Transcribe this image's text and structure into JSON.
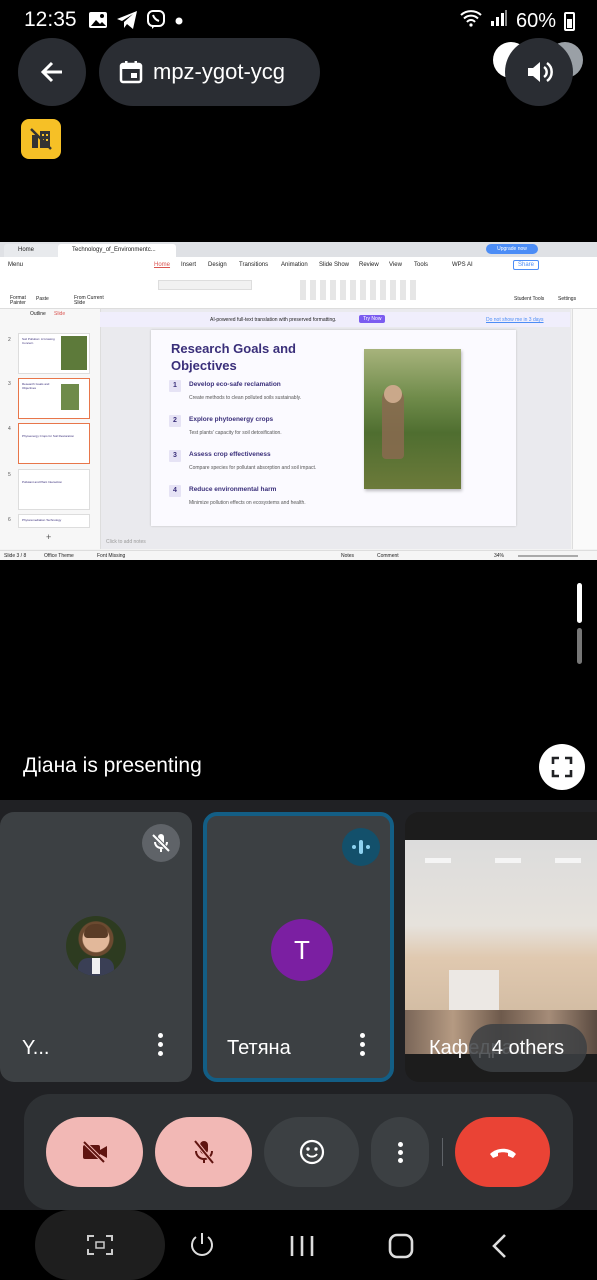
{
  "status_bar": {
    "time": "12:35",
    "battery": "60%",
    "left_icons": [
      "image-icon",
      "telegram-icon",
      "viber-icon",
      "dot-icon"
    ],
    "right_icons": [
      "wifi-icon",
      "signal-icon",
      "battery-icon"
    ]
  },
  "meeting": {
    "code": "mpz-ygot-ycg",
    "back_icon": "arrow-back-icon",
    "calendar_icon": "calendar-icon",
    "speaker_icon": "volume-icon",
    "badge_icon": "no-captions-icon"
  },
  "presentation": {
    "tabs": [
      {
        "label": "Home"
      },
      {
        "label": "Technology_of_Environmentc..."
      }
    ],
    "upgrade_label": "Upgrade now",
    "menu_label": "Menu",
    "ribbon_tabs": [
      "Home",
      "Insert",
      "Design",
      "Transitions",
      "Animation",
      "Slide Show",
      "Review",
      "View",
      "Tools",
      "WPS AI"
    ],
    "share_label": "Share",
    "ribbon_buttons": [
      "Format Painter",
      "Paste",
      "From Current Slide",
      "Student Tools",
      "Settings"
    ],
    "panel_tabs": [
      "Outline",
      "Slide"
    ],
    "banner": {
      "text": "AI-powered full-text translation with preserved formatting.",
      "try_now": "Try Now",
      "dismiss": "Do not show me in 3 days"
    },
    "thumbnails": [
      {
        "num": "2",
        "title": "Soil Pollution: A Growing Concern"
      },
      {
        "num": "3",
        "title": "Research Goals and Objectives"
      },
      {
        "num": "4",
        "title": "Phytoenergy Crops for Soil Restoration"
      },
      {
        "num": "5",
        "title": "Pollutant and Plant Interaction"
      },
      {
        "num": "6",
        "title": "Phytoremediation Technology"
      }
    ],
    "slide": {
      "title": "Research Goals and Objectives",
      "objectives": [
        {
          "num": "1",
          "title": "Develop eco-safe reclamation",
          "desc": "Create methods to clean polluted soils sustainably."
        },
        {
          "num": "2",
          "title": "Explore phytoenergy crops",
          "desc": "Test plants' capacity for soil detoxification."
        },
        {
          "num": "3",
          "title": "Assess crop effectiveness",
          "desc": "Compare species for pollutant absorption and soil impact."
        },
        {
          "num": "4",
          "title": "Reduce environmental harm",
          "desc": "Minimize pollution effects on ecosystems and health."
        }
      ]
    },
    "notes_placeholder": "Click to add notes",
    "status": {
      "slide": "Slide 3 / 8",
      "theme": "Office Theme",
      "font": "Font Missing",
      "notes": "Notes",
      "comment": "Comment",
      "zoom": "34%"
    }
  },
  "presenting_text": "Діана is presenting",
  "tiles": [
    {
      "name": "Y...",
      "muted": true,
      "avatar_icon": "profile-photo"
    },
    {
      "name": "Тетяна",
      "speaking": true,
      "initial": "T",
      "avatar_color": "#7b1fa2"
    },
    {
      "name": "Кафедра...",
      "others_label": "4 others"
    }
  ],
  "controls": {
    "camera_icon": "camera-off-icon",
    "mic_icon": "mic-off-icon",
    "reactions_icon": "emoji-icon",
    "more_icon": "more-vert-icon",
    "hangup_icon": "call-end-icon",
    "off_color": "#f2b8b5",
    "hangup_color": "#ea4335"
  },
  "nav": [
    "screenshot-icon",
    "power-icon",
    "recents-icon",
    "home-icon",
    "back-icon"
  ]
}
